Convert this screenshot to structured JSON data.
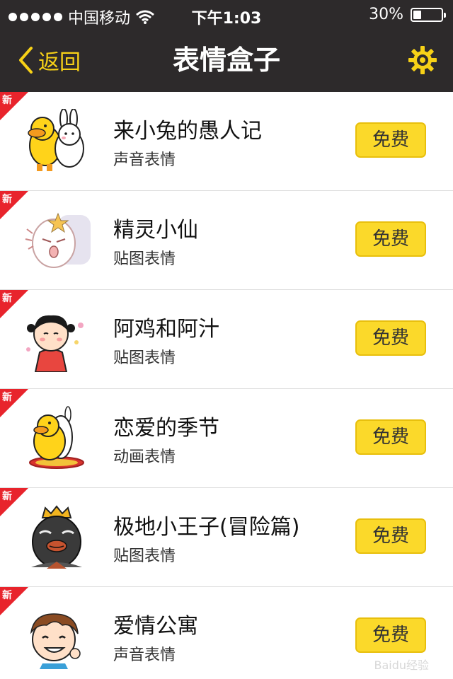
{
  "status_bar": {
    "carrier": "中国移动",
    "time": "下午1:03",
    "battery_percent": "30%",
    "battery_level": 0.3,
    "icons": [
      "signal-dots-icon",
      "wifi-icon",
      "battery-icon"
    ]
  },
  "navbar": {
    "back_label": "返回",
    "title": "表情盒子",
    "settings_icon": "gear-icon",
    "back_icon": "chevron-left-icon"
  },
  "new_badge_label": "新",
  "colors": {
    "bar_bg": "#2d2a2b",
    "accent_yellow": "#f7d117",
    "button_yellow": "#fbd92a",
    "badge_red": "#e8242c"
  },
  "items": [
    {
      "title": "来小兔的愚人记",
      "subtitle": "声音表情",
      "button": "免费",
      "icon": "duck-and-rabbit-sticker-icon"
    },
    {
      "title": "精灵小仙",
      "subtitle": "贴图表情",
      "button": "免费",
      "icon": "fairy-sticker-icon"
    },
    {
      "title": "阿鸡和阿汁",
      "subtitle": "贴图表情",
      "button": "免费",
      "icon": "girl-with-pigtails-sticker-icon"
    },
    {
      "title": "恋爱的季节",
      "subtitle": "动画表情",
      "button": "免费",
      "icon": "hugging-duck-rabbit-sticker-icon"
    },
    {
      "title": "极地小王子(冒险篇)",
      "subtitle": "贴图表情",
      "button": "免费",
      "icon": "crowned-bird-sticker-icon"
    },
    {
      "title": "爱情公寓",
      "subtitle": "声音表情",
      "button": "免费",
      "icon": "cartoon-boy-sticker-icon"
    }
  ],
  "watermark": "Baidu经验"
}
